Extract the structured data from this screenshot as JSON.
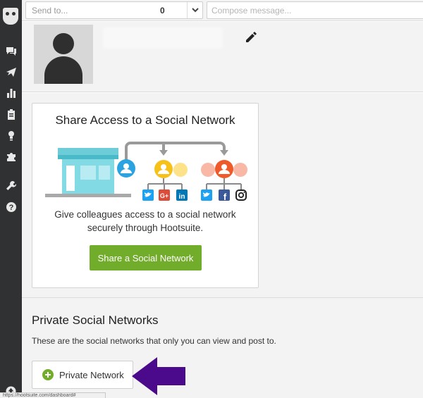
{
  "topbar": {
    "send_to_placeholder": "Send to...",
    "send_to_count": "0",
    "compose_placeholder": "Compose message..."
  },
  "sidebar": {
    "items": [
      {
        "icon": "streams-icon"
      },
      {
        "icon": "publisher-icon"
      },
      {
        "icon": "analytics-icon"
      },
      {
        "icon": "assignments-icon"
      },
      {
        "icon": "contacts-icon"
      },
      {
        "icon": "apps-icon"
      },
      {
        "icon": "tools-icon"
      },
      {
        "icon": "help-icon"
      }
    ]
  },
  "share_card": {
    "title": "Share Access to a Social Network",
    "description": "Give colleagues access to a social network securely through Hootsuite.",
    "button_label": "Share a Social Network"
  },
  "private_section": {
    "title": "Private Social Networks",
    "description": "These are the social networks that only you can view and post to.",
    "button_label": "Private Network"
  },
  "statusbar": {
    "url": "https://hootsuite.com/dashboard#"
  },
  "colors": {
    "sidebar_bg": "#2f3133",
    "accent_green": "#72ac2b",
    "arrow_purple": "#4b0a8c",
    "twitter": "#1da1f2",
    "google_plus": "#dd4b39",
    "linkedin": "#0077b5",
    "facebook": "#3b5998"
  }
}
